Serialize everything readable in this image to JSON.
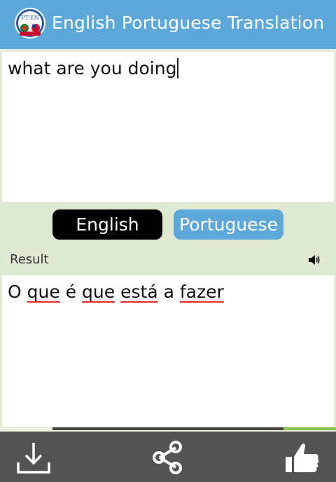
{
  "app": {
    "title": "English Portuguese Translation",
    "logo_text": "PT-EN",
    "colors": {
      "accent": "#5ea8d9",
      "background": "#dfe9d4",
      "bottom_bar": "#535353"
    }
  },
  "source": {
    "text": "what are you doing"
  },
  "languages": {
    "source_label": "English",
    "target_label": "Portuguese"
  },
  "result": {
    "label": "Result",
    "words": [
      "O",
      "que",
      "é",
      "que",
      "está",
      "a",
      "fazer"
    ]
  },
  "bottom_bar": {
    "icons": [
      "download-icon",
      "share-icon",
      "thumbs-up-icon"
    ]
  }
}
